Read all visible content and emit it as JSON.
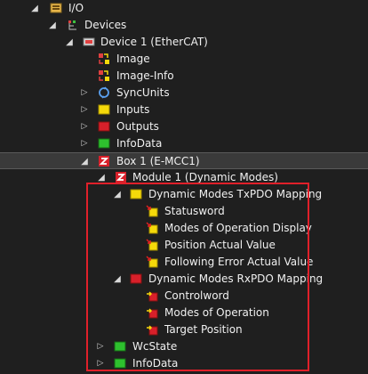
{
  "tree": {
    "io": "I/O",
    "devices": "Devices",
    "device1": "Device 1 (EtherCAT)",
    "image": "Image",
    "image_info": "Image-Info",
    "syncunits": "SyncUnits",
    "inputs": "Inputs",
    "outputs": "Outputs",
    "infodata": "InfoData",
    "box1": "Box 1 (E-MCC1)",
    "module1": "Module 1 (Dynamic Modes)",
    "txpdo": "Dynamic Modes TxPDO Mapping",
    "statusword": "Statusword",
    "modes_display": "Modes of Operation Display",
    "position_actual": "Position Actual Value",
    "following_error": "Following Error Actual Value",
    "rxpdo": "Dynamic Modes RxPDO Mapping",
    "controlword": "Controlword",
    "modes_operation": "Modes of Operation",
    "target_position": "Target Position",
    "wcstate": "WcState",
    "infodata2": "InfoData"
  },
  "colors": {
    "background": "#1f1f1f",
    "selected_row": "#3a3a3a",
    "highlight_border": "#e0202a",
    "input_yellow": "#f5d90a",
    "output_red": "#d8202a",
    "state_green": "#2ec12e"
  },
  "icons": {
    "io": "io-folder-icon",
    "devices": "devices-icon",
    "device": "ethercat-device-icon",
    "image": "image-icon",
    "syncunits": "syncunits-icon",
    "inputs": "inputs-icon",
    "outputs": "outputs-icon",
    "infodata": "infodata-icon",
    "box": "box-z-icon",
    "module": "module-z-icon",
    "input_var": "input-variable-icon",
    "output_var": "output-variable-icon"
  }
}
